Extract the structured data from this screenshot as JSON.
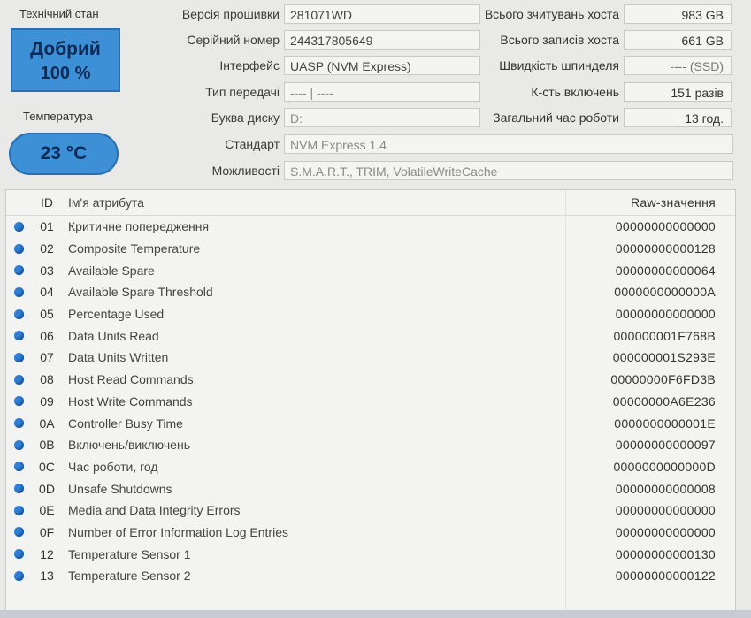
{
  "status": {
    "tech_state_label": "Технічний стан",
    "health_status": "Добрий",
    "health_percent": "100 %",
    "temperature_label": "Температура",
    "temperature_value": "23 °C"
  },
  "info_fields": [
    {
      "label": "Версія прошивки",
      "value": "281071WD"
    },
    {
      "label": "Серійний номер",
      "value": "244317805649"
    },
    {
      "label": "Інтерфейс",
      "value": "UASP (NVM Express)"
    },
    {
      "label": "Тип передачі",
      "value": "---- | ----"
    },
    {
      "label": "Буква диску",
      "value": "D:"
    },
    {
      "label": "Стандарт",
      "value": "NVM Express 1.4"
    },
    {
      "label": "Можливості",
      "value": "S.M.A.R.T., TRIM, VolatileWriteCache"
    }
  ],
  "right_fields": [
    {
      "label": "Всього зчитувань хоста",
      "value": "983 GB"
    },
    {
      "label": "Всього записів хоста",
      "value": "661 GB"
    },
    {
      "label": "Швидкість шпинделя",
      "value": "---- (SSD)"
    },
    {
      "label": "К-сть включень",
      "value": "151 разів"
    },
    {
      "label": "Загальний час роботи",
      "value": "13 год."
    }
  ],
  "table": {
    "headers": {
      "id": "ID",
      "name": "Ім'я атрибута",
      "raw": "Raw-значення"
    },
    "status_color": "#2f7fd6",
    "rows": [
      {
        "id": "01",
        "name": "Критичне попередження",
        "raw": "00000000000000"
      },
      {
        "id": "02",
        "name": "Composite Temperature",
        "raw": "00000000000128"
      },
      {
        "id": "03",
        "name": "Available Spare",
        "raw": "00000000000064"
      },
      {
        "id": "04",
        "name": "Available Spare Threshold",
        "raw": "0000000000000A"
      },
      {
        "id": "05",
        "name": "Percentage Used",
        "raw": "00000000000000"
      },
      {
        "id": "06",
        "name": "Data Units Read",
        "raw": "000000001F768B"
      },
      {
        "id": "07",
        "name": "Data Units Written",
        "raw": "000000001S293E"
      },
      {
        "id": "08",
        "name": "Host Read Commands",
        "raw": "00000000F6FD3B"
      },
      {
        "id": "09",
        "name": "Host Write Commands",
        "raw": "00000000A6E236"
      },
      {
        "id": "0A",
        "name": "Controller Busy Time",
        "raw": "0000000000001E"
      },
      {
        "id": "0B",
        "name": "Включень/виключень",
        "raw": "00000000000097"
      },
      {
        "id": "0C",
        "name": "Час роботи, год",
        "raw": "0000000000000D"
      },
      {
        "id": "0D",
        "name": "Unsafe Shutdowns",
        "raw": "00000000000008"
      },
      {
        "id": "0E",
        "name": "Media and Data Integrity Errors",
        "raw": "00000000000000"
      },
      {
        "id": "0F",
        "name": "Number of Error Information Log Entries",
        "raw": "00000000000000"
      },
      {
        "id": "12",
        "name": "Temperature Sensor 1",
        "raw": "00000000000130"
      },
      {
        "id": "13",
        "name": "Temperature Sensor 2",
        "raw": "00000000000122"
      }
    ]
  }
}
